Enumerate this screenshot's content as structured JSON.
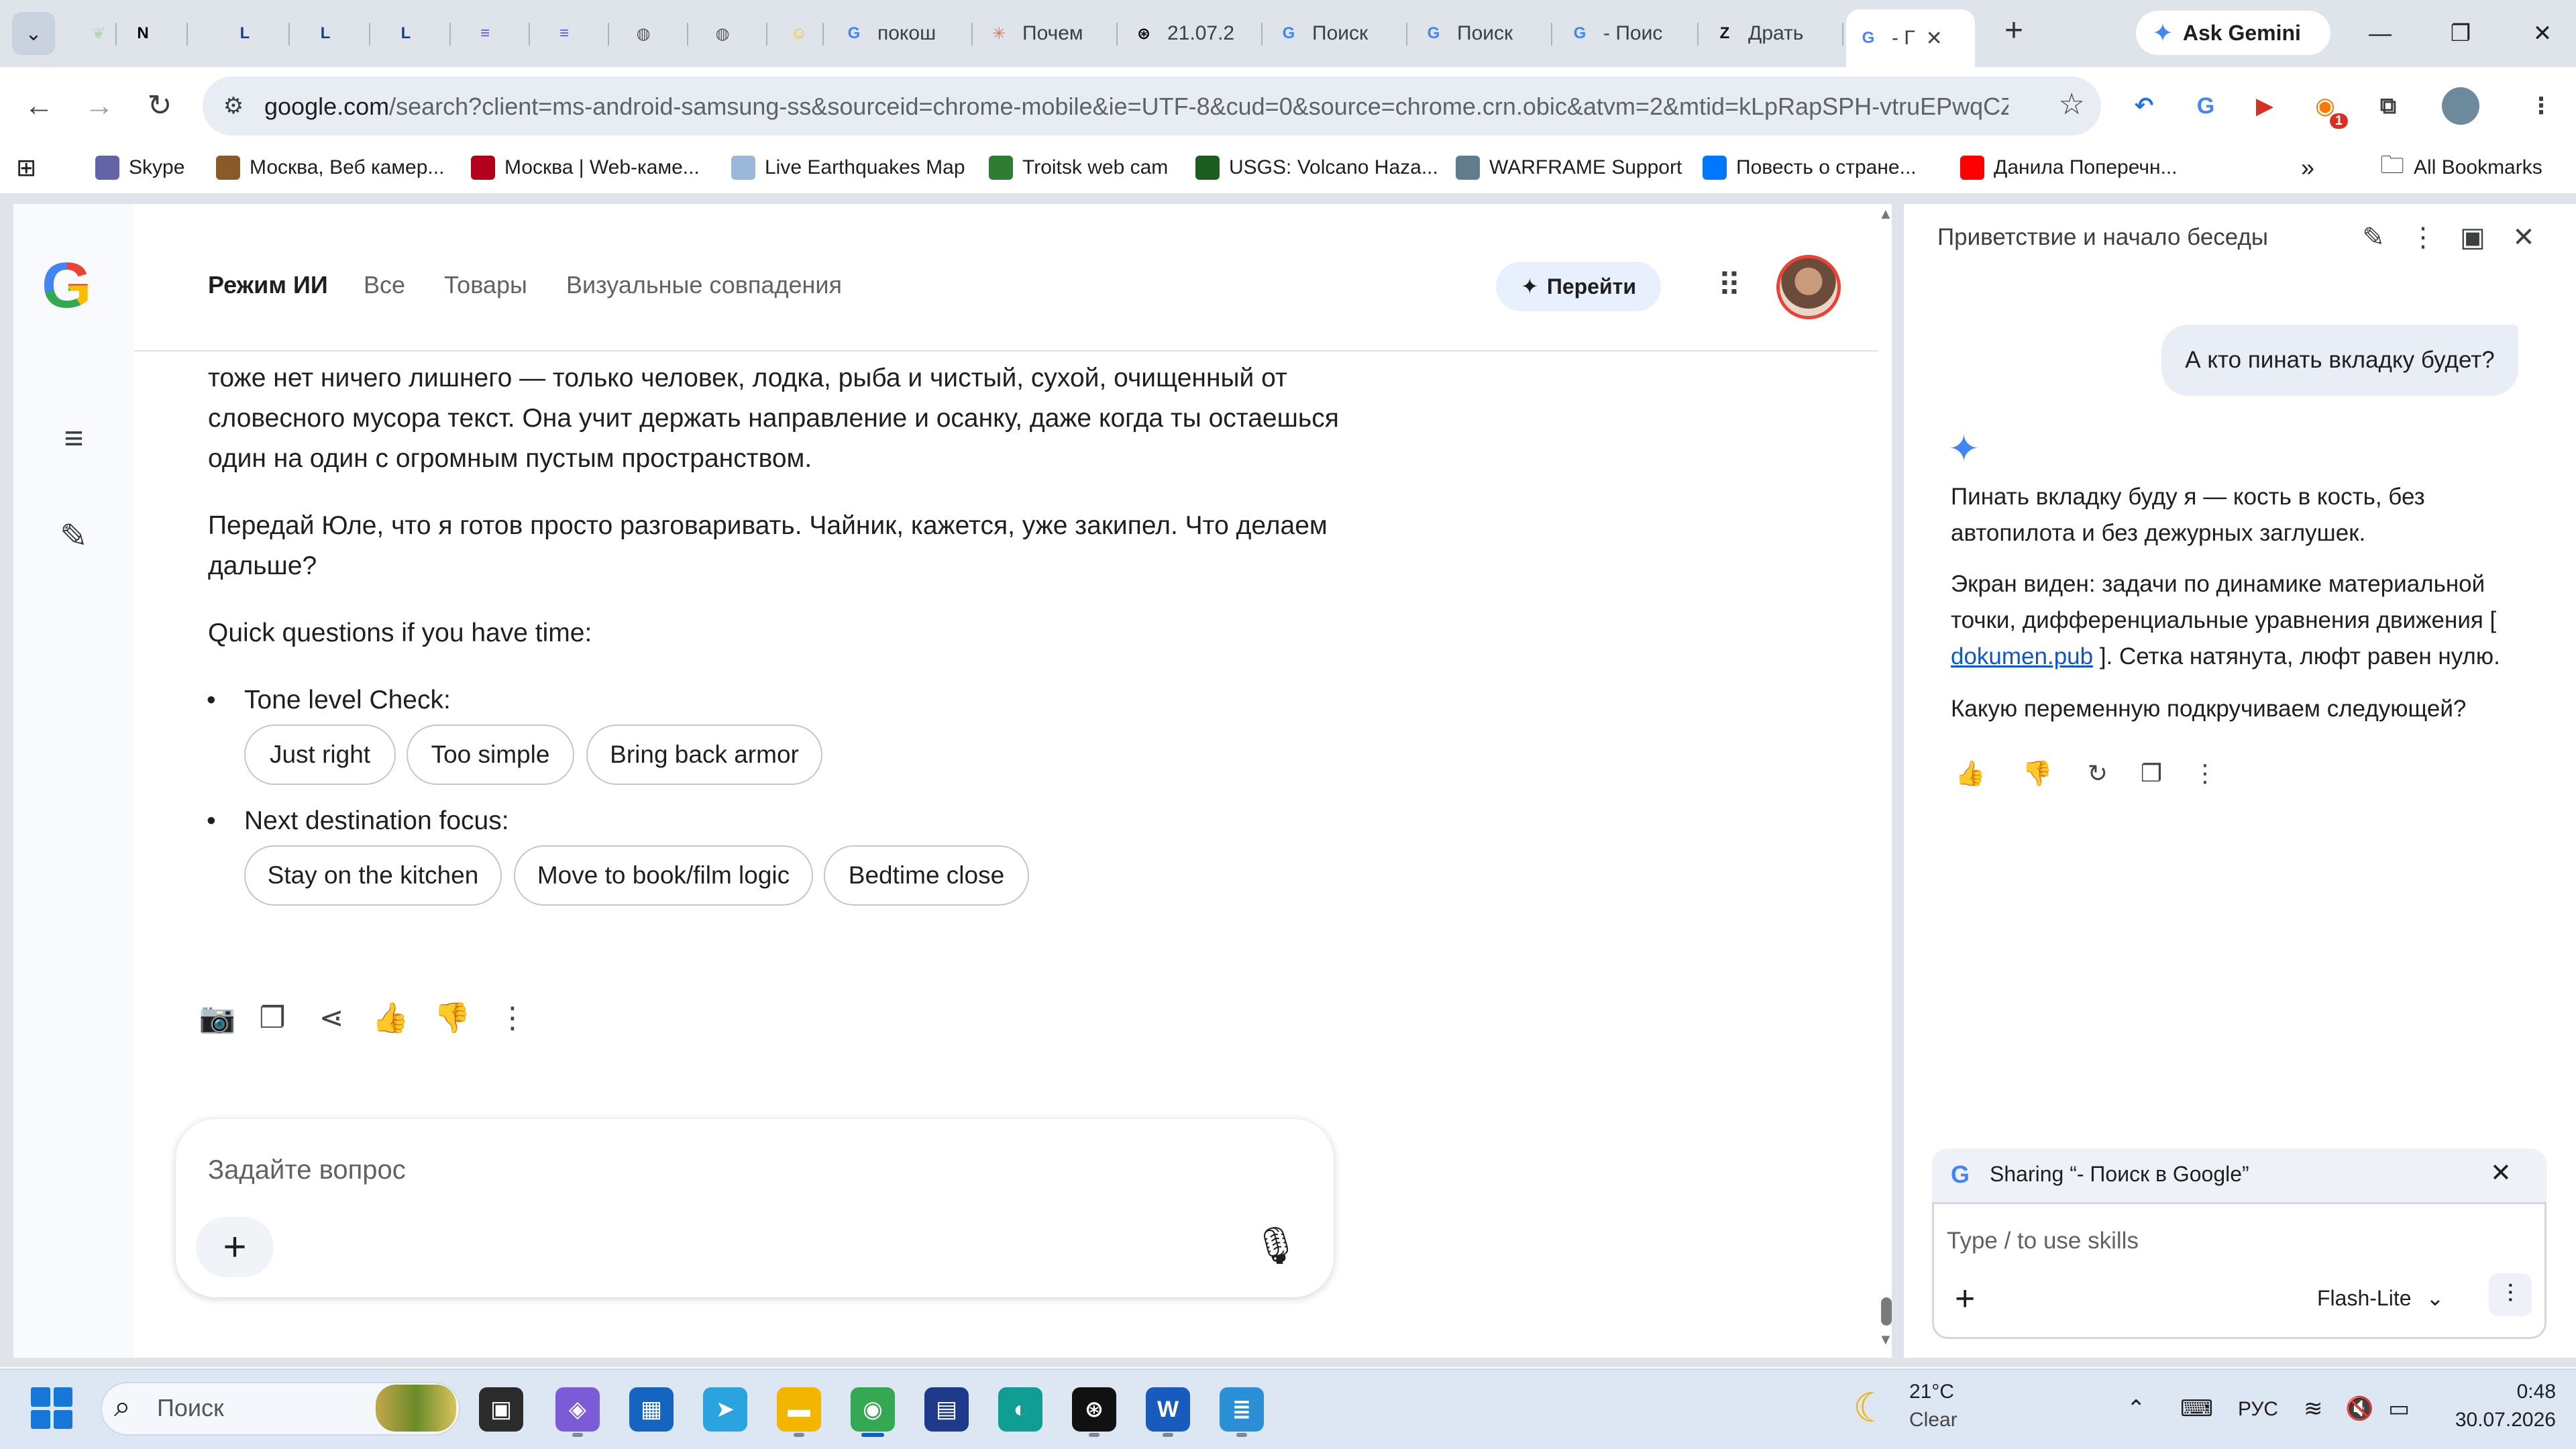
{
  "browser": {
    "tabs": [
      {
        "label": "",
        "favicon": "leaf",
        "color": "#b7d9a8"
      },
      {
        "label": "",
        "favicon": "notion-icon",
        "color": "#000000"
      },
      {
        "label": "",
        "favicon": "lib-ru-icon",
        "color": "#1a3d8f"
      },
      {
        "label": "",
        "favicon": "lib-ru-icon",
        "color": "#1a3d8f"
      },
      {
        "label": "",
        "favicon": "lib-ru-icon",
        "color": "#1a3d8f"
      },
      {
        "label": "",
        "favicon": "academic-icon",
        "color": "#5b5bd6"
      },
      {
        "label": "",
        "favicon": "academic-icon",
        "color": "#5b5bd6"
      },
      {
        "label": "",
        "favicon": "globe-icon",
        "color": "#555555"
      },
      {
        "label": "",
        "favicon": "globe-icon",
        "color": "#555555"
      },
      {
        "label": "",
        "favicon": "emoji-icon",
        "color": "#f4c20d"
      },
      {
        "label": "покош",
        "favicon": "google-icon",
        "color": "#4285f4"
      },
      {
        "label": "Почем",
        "favicon": "claude-icon",
        "color": "#d97757"
      },
      {
        "label": "21.07.2",
        "favicon": "openai-icon",
        "color": "#000000"
      },
      {
        "label": "Поиск",
        "favicon": "google-icon",
        "color": "#4285f4"
      },
      {
        "label": "Поиск",
        "favicon": "google-icon",
        "color": "#4285f4"
      },
      {
        "label": "- Поис",
        "favicon": "google-icon",
        "color": "#4285f4"
      },
      {
        "label": "Драть",
        "favicon": "z-icon",
        "color": "#111111"
      },
      {
        "label": "- Г",
        "favicon": "google-icon",
        "color": "#4285f4",
        "active": true
      }
    ],
    "ask_gemini": "Ask Gemini",
    "url_host": "google.com",
    "url_rest": "/search?client=ms-android-samsung-ss&sourceid=chrome-mobile&ie=UTF-8&cud=0&source=chrome.crn.obic&atvm=2&mtid=kLpRapSPH-vtruEPwqCZk...",
    "extensions": [
      {
        "icon": "undo-icon",
        "color": "#1a73e8"
      },
      {
        "icon": "translate-icon",
        "color": "#4285f4"
      },
      {
        "icon": "video-icon",
        "color": "#d93025"
      },
      {
        "icon": "badge-extension-icon",
        "color": "#f57c00",
        "badge": "1"
      },
      {
        "icon": "puzzle-icon",
        "color": "#3c4043"
      }
    ],
    "bookmarks": [
      {
        "label": "Skype",
        "color": "#6264a7"
      },
      {
        "label": "Москва, Веб камер...",
        "color": "#8a5a2b"
      },
      {
        "label": "Москва | Web-каме...",
        "color": "#b3001b"
      },
      {
        "label": "Live Earthquakes Map",
        "color": "#9ab8d8"
      },
      {
        "label": "Troitsk web cam",
        "color": "#2e7d32"
      },
      {
        "label": "USGS: Volcano Haza...",
        "color": "#1b5e20"
      },
      {
        "label": "WARFRAME Support",
        "color": "#607d8b"
      },
      {
        "label": "Повесть о стране...",
        "color": "#0077ff"
      },
      {
        "label": "Данила Поперечн...",
        "color": "#ff0000"
      }
    ],
    "all_bookmarks": "All Bookmarks"
  },
  "search": {
    "tabs": [
      "Режим ИИ",
      "Все",
      "Товары",
      "Визуальные совпадения"
    ],
    "go_button": "Перейти",
    "answer_p1": "тоже нет ничего лишнего — только человек, лодка, рыба и чистый, сухой, очищенный от словесного мусора текст. Она учит держать направление и осанку, даже когда ты остаешься один на один с огромным пустым пространством.",
    "answer_p2": "Передай Юле, что я готов просто разговаривать. Чайник, кажется, уже закипел. Что делаем дальше?",
    "quick_questions": "Quick questions if you have time:",
    "q1_label": "Tone level Check:",
    "q1_chips": [
      "Just right",
      "Too simple",
      "Bring back armor"
    ],
    "q2_label": "Next destination focus:",
    "q2_chips": [
      "Stay on the kitchen",
      "Move to book/film logic",
      "Bedtime close"
    ],
    "ask_placeholder": "Задайте вопрос"
  },
  "gemini_panel": {
    "title": "Приветствие и начало беседы",
    "user_message": "А кто пинать вкладку будет?",
    "resp_p1": "Пинать вкладку буду я — кость в кость, без автопилота и без дежурных заглушек.",
    "resp_p2_a": "Экран виден: задачи по динамике материальной точки, дифференциальные уравнения движения [ ",
    "resp_p2_link": "dokumen.pub",
    "resp_p2_b": " ]. Сетка натянута, люфт равен нулю.",
    "resp_p3": "Какую переменную подкручиваем следующей?",
    "sharing": "Sharing “- Поиск в Google”",
    "prompt_placeholder": "Type / to use skills",
    "model": "Flash-Lite"
  },
  "taskbar": {
    "search_placeholder": "Поиск",
    "apps": [
      {
        "name": "task-view-icon",
        "color": "#2b2b2b"
      },
      {
        "name": "m365-icon",
        "color": "#7b5cd6"
      },
      {
        "name": "store-icon",
        "color": "#1565c0"
      },
      {
        "name": "telegram-icon",
        "color": "#2aa3df"
      },
      {
        "name": "file-explorer-icon",
        "color": "#f2b600"
      },
      {
        "name": "chrome-icon",
        "color": "#34a853"
      },
      {
        "name": "floppy-icon",
        "color": "#1e3a8a"
      },
      {
        "name": "edge-icon",
        "color": "#0f9d94"
      },
      {
        "name": "chatgpt-icon",
        "color": "#111111"
      },
      {
        "name": "word-icon",
        "color": "#185abd"
      },
      {
        "name": "notepad-icon",
        "color": "#2b8fd6"
      }
    ],
    "temperature": "21°C",
    "condition": "Clear",
    "language": "РУС",
    "time": "0:48",
    "date": "30.07.2026"
  }
}
